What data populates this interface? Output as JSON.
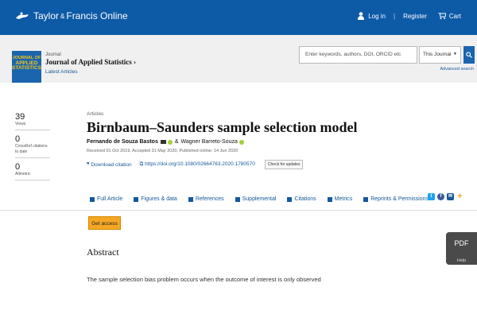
{
  "brand": {
    "name_left": "Taylor",
    "amp": "&",
    "name_right": "Francis Online"
  },
  "topnav": {
    "login": "Log in",
    "register": "Register",
    "cart": "Cart"
  },
  "journal": {
    "cover_lines": [
      "JOURNAL OF",
      "APPLIED",
      "STATISTICS"
    ],
    "label": "Journal",
    "name": "Journal of Applied Statistics ›",
    "latest": "Latest Articles"
  },
  "search": {
    "placeholder": "Enter keywords, authors, DOI, ORCID etc",
    "scope": "This Journal",
    "advanced": "Advanced search"
  },
  "metrics": [
    {
      "value": "39",
      "label": "Views"
    },
    {
      "value": "0",
      "label": "CrossRef citations to date"
    },
    {
      "value": "0",
      "label": "Altmetric"
    }
  ],
  "article": {
    "type": "Articles",
    "title": "Birnbaum–Saunders sample selection model",
    "author1": "Fernando de Souza Bastos",
    "author_sep": "&",
    "author2": "Wagner Barreto-Souza",
    "dates": "Received 01 Oct 2019, Accepted 31 May 2020, Published online: 14 Jun 2020",
    "download": "Download citation",
    "doi": "https://doi.org/10.1080/02664763.2020.1780570",
    "check": "Check for updates"
  },
  "tabs": [
    "Full Article",
    "Figures & data",
    "References",
    "Supplemental",
    "Citations",
    "Metrics",
    "Reprints & Permissions"
  ],
  "access_label": "Get access",
  "abstract": {
    "heading": "Abstract",
    "text": "The sample selection bias problem occurs when the outcome of interest is only observed"
  },
  "pdf": {
    "label": "PDF",
    "help": "Help"
  },
  "colors": {
    "topbar": "#0d5aa7",
    "link": "#14589a",
    "access": "#f5a623"
  }
}
